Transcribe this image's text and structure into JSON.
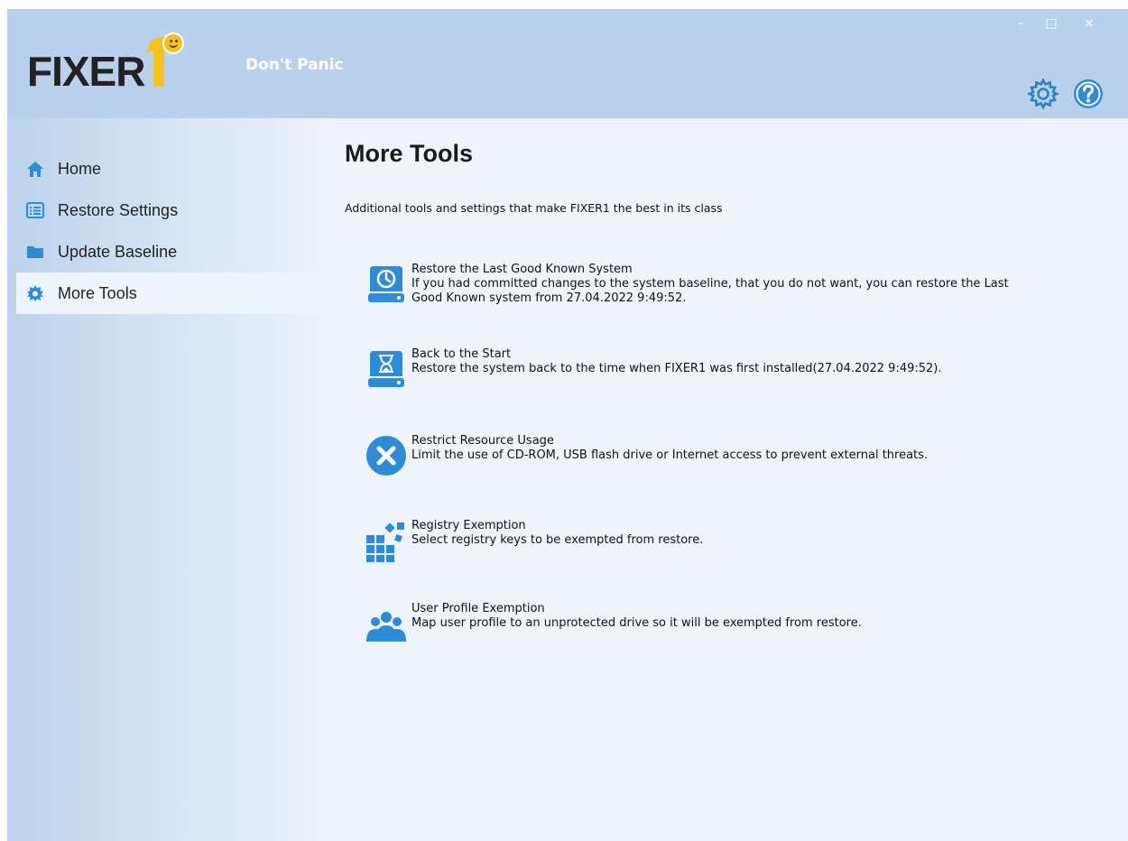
{
  "app": {
    "logo_text": "FIXER",
    "tagline": "Don't Panic",
    "window_controls": {
      "minimize": "–",
      "maximize": "□",
      "close": "×"
    }
  },
  "header": {
    "icons": [
      "gear-icon",
      "help-icon"
    ]
  },
  "sidebar": {
    "items": [
      {
        "label": "Home",
        "icon": "home-icon",
        "active": false
      },
      {
        "label": "Restore Settings",
        "icon": "list-icon",
        "active": false
      },
      {
        "label": "Update Baseline",
        "icon": "folder-icon",
        "active": false
      },
      {
        "label": "More Tools",
        "icon": "gear-icon",
        "active": true
      }
    ]
  },
  "main": {
    "title": "More Tools",
    "subtitle": "Additional tools and settings that make FIXER1 the best in its class",
    "tools": [
      {
        "title": "Restore the Last Good Known System",
        "description": "If you had committed changes to the system baseline, that you do not want, you can restore the Last",
        "description_2": "Good Known system from 27.04.2022 9:49:52.",
        "icon": "clock-drive-icon"
      },
      {
        "title": "Back to the Start",
        "description": "Restore the system back to the time when FIXER1 was first installed(27.04.2022 9:49:52).",
        "icon": "hourglass-drive-icon"
      },
      {
        "title": "Restrict Resource Usage",
        "description": "Limit the use of CD-ROM, USB flash drive or Internet access to prevent external threats.",
        "icon": "block-x-icon"
      },
      {
        "title": "Registry Exemption",
        "description": "Select registry keys to be exempted from restore.",
        "icon": "registry-blocks-icon"
      },
      {
        "title": "User Profile Exemption",
        "description": "Map user profile to an unprotected drive so it will be exempted from restore.",
        "icon": "users-icon"
      }
    ]
  },
  "colors": {
    "header_bg": "#b9d1ea",
    "content_bg": "#eef4fb",
    "accent_blue": "#2e8bd6",
    "logo_yellow": "#f5c220"
  }
}
